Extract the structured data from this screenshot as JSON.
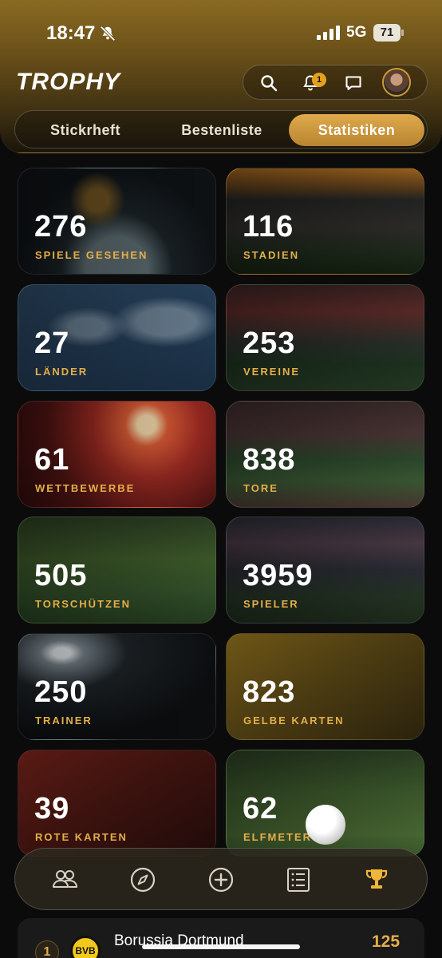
{
  "status_bar": {
    "time": "18:47",
    "network": "5G",
    "battery": "71"
  },
  "header": {
    "app_title": "TROPHY",
    "notification_count": "1",
    "icons": [
      "search-icon",
      "bell-icon",
      "chat-icon",
      "avatar"
    ]
  },
  "tabs": [
    {
      "label": "Stickrheft",
      "active": false
    },
    {
      "label": "Bestenliste",
      "active": false
    },
    {
      "label": "Statistiken",
      "active": true
    }
  ],
  "stats": [
    {
      "value": "276",
      "label": "SPIELE GESEHEN"
    },
    {
      "value": "116",
      "label": "STADIEN"
    },
    {
      "value": "27",
      "label": "LÄNDER"
    },
    {
      "value": "253",
      "label": "VEREINE"
    },
    {
      "value": "61",
      "label": "WETTBEWERBE"
    },
    {
      "value": "838",
      "label": "TORE"
    },
    {
      "value": "505",
      "label": "TORSCHÜTZEN"
    },
    {
      "value": "3959",
      "label": "SPIELER"
    },
    {
      "value": "250",
      "label": "TRAINER"
    },
    {
      "value": "823",
      "label": "GELBE KARTEN"
    },
    {
      "value": "39",
      "label": "ROTE KARTEN"
    },
    {
      "value": "62",
      "label": "ELFMETER"
    }
  ],
  "bottom_nav": [
    "people-icon",
    "compass-icon",
    "plus-circle-icon",
    "list-icon",
    "trophy-icon"
  ],
  "bottom_nav_active": "trophy-icon",
  "ranking_preview": {
    "rank": "1",
    "club_logo_text": "BVB",
    "club_name": "Borussia Dortmund",
    "count": "125"
  },
  "colors": {
    "accent": "#e5ae4a",
    "header_gold": "#8a6a22",
    "background": "#0b0b0b"
  }
}
